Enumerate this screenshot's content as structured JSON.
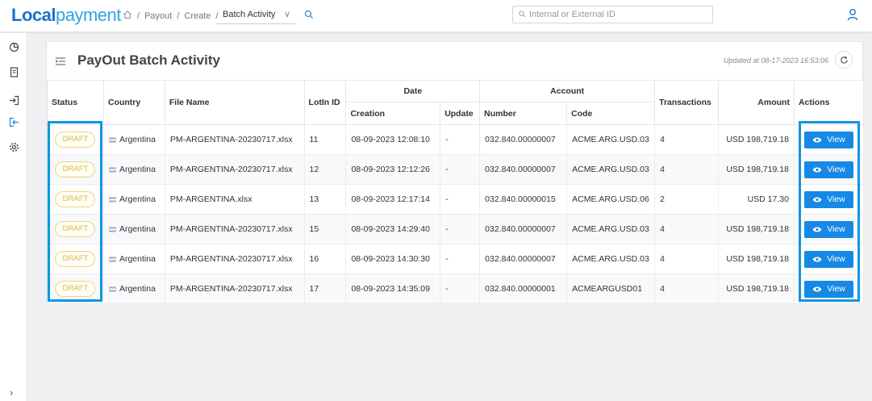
{
  "header": {
    "logo_part1": "Local",
    "logo_part2": "payment",
    "breadcrumbs": [
      "Payout",
      "Create"
    ],
    "breadcrumb_select": "Batch Activity",
    "search_placeholder": "Internal or External ID"
  },
  "card": {
    "title": "PayOut Batch Activity",
    "updated": "Updated at 08-17-2023 16:53:06"
  },
  "table": {
    "headers": {
      "status": "Status",
      "country": "Country",
      "file_name": "File Name",
      "lotin_id": "LotIn ID",
      "date": "Date",
      "creation": "Creation",
      "update": "Update",
      "account": "Account",
      "number": "Number",
      "code": "Code",
      "transactions": "Transactions",
      "amount": "Amount",
      "actions": "Actions"
    },
    "rows": [
      {
        "status": "DRAFT",
        "country": "Argentina",
        "file": "PM-ARGENTINA-20230717.xlsx",
        "lotin": "11",
        "creation": "08-09-2023 12:08:10",
        "update": "-",
        "number": "032.840.00000007",
        "code": "ACME.ARG.USD.03",
        "transactions": "4",
        "amount": "USD 198,719.18",
        "action": "View"
      },
      {
        "status": "DRAFT",
        "country": "Argentina",
        "file": "PM-ARGENTINA-20230717.xlsx",
        "lotin": "12",
        "creation": "08-09-2023 12:12:26",
        "update": "-",
        "number": "032.840.00000007",
        "code": "ACME.ARG.USD.03",
        "transactions": "4",
        "amount": "USD 198,719.18",
        "action": "View"
      },
      {
        "status": "DRAFT",
        "country": "Argentina",
        "file": "PM-ARGENTINA.xlsx",
        "lotin": "13",
        "creation": "08-09-2023 12:17:14",
        "update": "-",
        "number": "032.840.00000015",
        "code": "ACME.ARG.USD.06",
        "transactions": "2",
        "amount": "USD 17.30",
        "action": "View"
      },
      {
        "status": "DRAFT",
        "country": "Argentina",
        "file": "PM-ARGENTINA-20230717.xlsx",
        "lotin": "15",
        "creation": "08-09-2023 14:29:40",
        "update": "-",
        "number": "032.840.00000007",
        "code": "ACME.ARG.USD.03",
        "transactions": "4",
        "amount": "USD 198,719.18",
        "action": "View"
      },
      {
        "status": "DRAFT",
        "country": "Argentina",
        "file": "PM-ARGENTINA-20230717.xlsx",
        "lotin": "16",
        "creation": "08-09-2023 14:30:30",
        "update": "-",
        "number": "032.840.00000007",
        "code": "ACME.ARG.USD.03",
        "transactions": "4",
        "amount": "USD 198,719.18",
        "action": "View"
      },
      {
        "status": "DRAFT",
        "country": "Argentina",
        "file": "PM-ARGENTINA-20230717.xlsx",
        "lotin": "17",
        "creation": "08-09-2023 14:35:09",
        "update": "-",
        "number": "032.840.00000001",
        "code": "ACMEARGUSD01",
        "transactions": "4",
        "amount": "USD 198,719.18",
        "action": "View"
      }
    ]
  },
  "colors": {
    "primary": "#1689e6",
    "highlight": "#0c96e3",
    "draft": "#d8b94a"
  }
}
